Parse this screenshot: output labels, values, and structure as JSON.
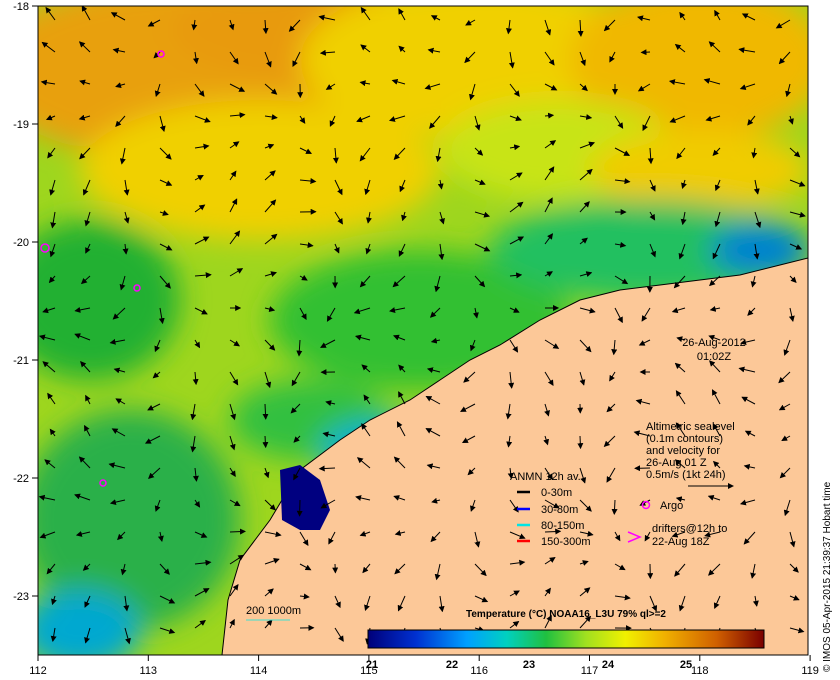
{
  "map": {
    "date": "26-Aug-2012",
    "time": "01:02Z",
    "lon_ticks": [
      "112",
      "113",
      "114",
      "115",
      "116",
      "117",
      "118",
      "119"
    ],
    "lat_ticks": [
      "-18",
      "-19",
      "-20",
      "-21",
      "-22",
      "-23"
    ],
    "info": [
      "Altimetric sealevel",
      "(0.1m contours)",
      "and velocity for",
      "26-Aug 01 Z",
      "0.5m/s (1kt 24h)"
    ],
    "legend": {
      "title": "ANMN 12h av.",
      "items": [
        {
          "label": "0-30m",
          "color": "#000000"
        },
        {
          "label": "30-80m",
          "color": "#0000ff"
        },
        {
          "label": "80-150m",
          "color": "#00e5e5"
        },
        {
          "label": "150-300m",
          "color": "#ff0000"
        }
      ],
      "argo": "Argo",
      "drifters": [
        "drifters@12h to",
        "22-Aug 18Z"
      ]
    },
    "isobath_label": "200  1000m",
    "colorbar": {
      "title": "Temperature (°C) NOAA16_L3U 79% ql>=2",
      "ticks": [
        "21",
        "22",
        "23",
        "24",
        "25"
      ]
    },
    "credit": "© IMOS 05-Apr-2015 21:39:37 Hobart time"
  }
}
